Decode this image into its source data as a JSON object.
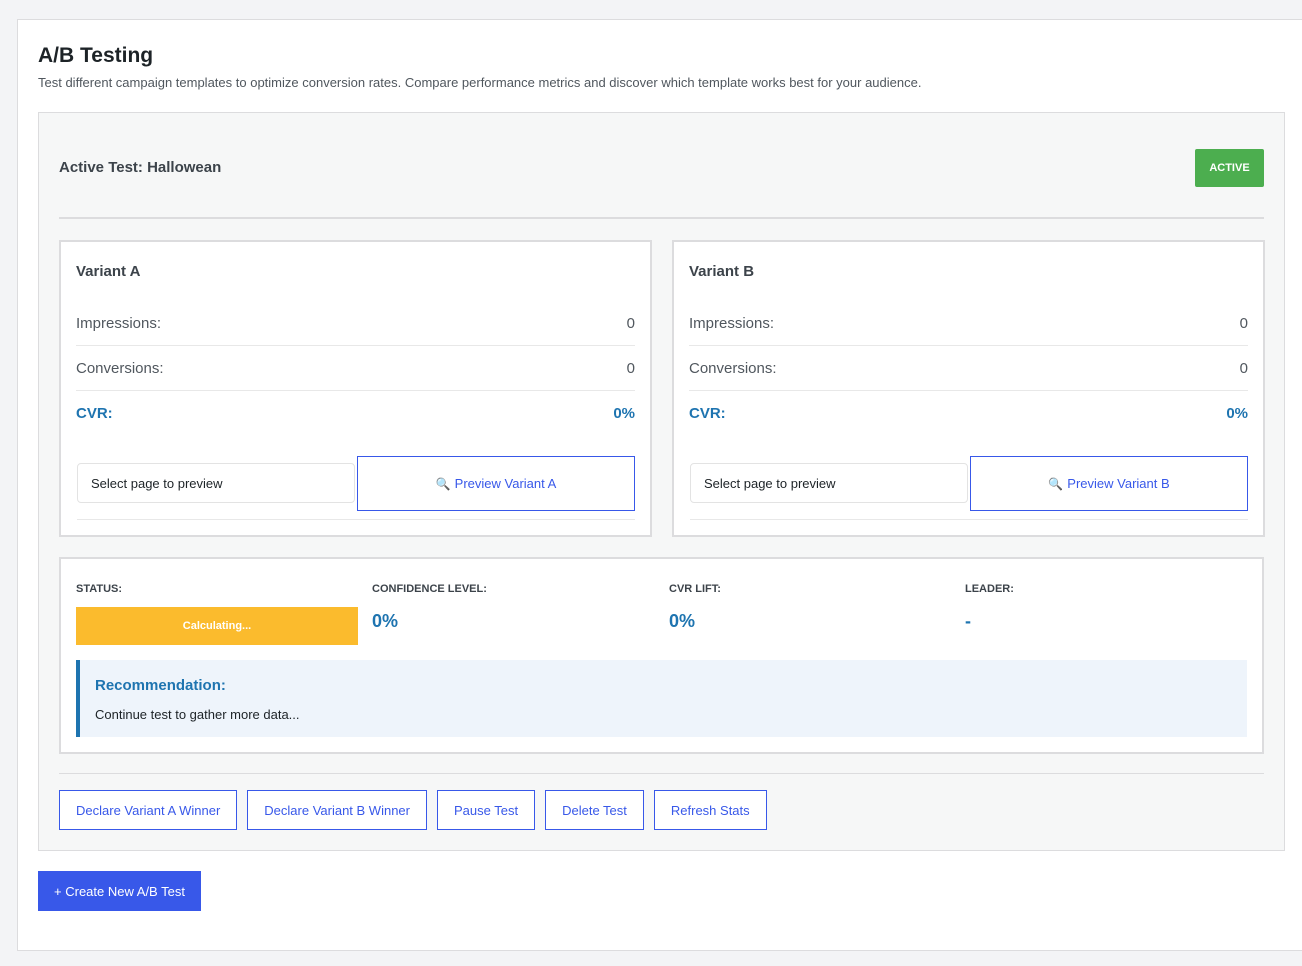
{
  "header": {
    "title": "A/B Testing",
    "description": "Test different campaign templates to optimize conversion rates. Compare performance metrics and discover which template works best for your audience."
  },
  "test": {
    "title": "Active Test: Hallowean",
    "status_badge": "ACTIVE",
    "colors": {
      "badge": "#4cae4f",
      "accent": "#1e74b0",
      "button": "#3858e9",
      "pending": "#fbbb2d"
    }
  },
  "variants": [
    {
      "title": "Variant A",
      "impressions_label": "Impressions:",
      "impressions": "0",
      "conversions_label": "Conversions:",
      "conversions": "0",
      "cvr_label": "CVR:",
      "cvr": "0%",
      "select_placeholder": "Select page to preview",
      "preview_icon": "magnifier-icon",
      "preview_label": "Preview Variant A"
    },
    {
      "title": "Variant B",
      "impressions_label": "Impressions:",
      "impressions": "0",
      "conversions_label": "Conversions:",
      "conversions": "0",
      "cvr_label": "CVR:",
      "cvr": "0%",
      "select_placeholder": "Select page to preview",
      "preview_icon": "magnifier-icon",
      "preview_label": "Preview Variant B"
    }
  ],
  "results": {
    "status_label": "STATUS:",
    "status_value": "Calculating...",
    "confidence_label": "CONFIDENCE LEVEL:",
    "confidence_value": "0%",
    "lift_label": "CVR LIFT:",
    "lift_value": "0%",
    "leader_label": "LEADER:",
    "leader_value": "-",
    "recommendation_title": "Recommendation:",
    "recommendation_text": "Continue test to gather more data..."
  },
  "actions": {
    "declare_a": "Declare Variant A Winner",
    "declare_b": "Declare Variant B Winner",
    "pause": "Pause Test",
    "delete": "Delete Test",
    "refresh": "Refresh Stats"
  },
  "create_button": "+ Create New A/B Test"
}
